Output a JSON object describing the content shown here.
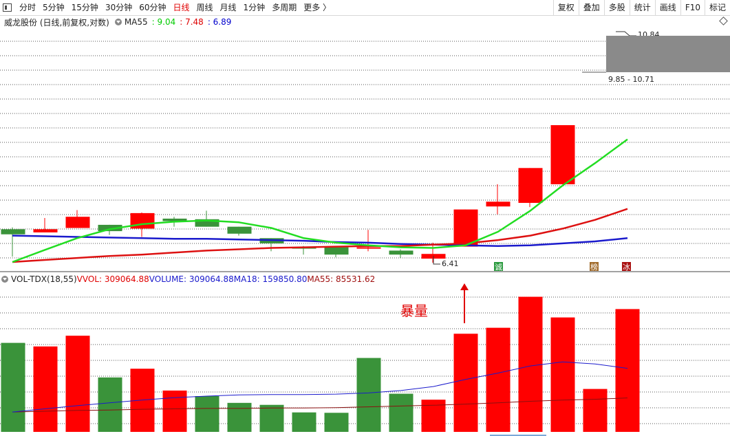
{
  "toolbar": {
    "tabs": [
      "分时",
      "5分钟",
      "15分钟",
      "30分钟",
      "60分钟",
      "日线",
      "周线",
      "月线",
      "1分钟",
      "多周期",
      "更多 〉"
    ],
    "active_tab": "日线",
    "right_buttons": [
      "复权",
      "叠加",
      "多股",
      "统计",
      "画线",
      "F10",
      "标记"
    ]
  },
  "price_panel": {
    "title": "威龙股份 (日线,前复权,对数)",
    "ma_label": "MA55",
    "ma_values": [
      ": 9.04",
      ": 7.48",
      ": 6.89"
    ],
    "ma_colors": [
      "#00cc00",
      "#dd0000",
      "#0000cc"
    ],
    "high_label": "10.84",
    "low_label": "6.41",
    "range_label": "9.85 - 10.71",
    "markers": [
      {
        "text": "诚",
        "color": "#2a9a3e"
      },
      {
        "text": "榜",
        "color": "#a06a2a"
      },
      {
        "text": "冰",
        "color": "#aa1111"
      }
    ]
  },
  "volume_panel": {
    "indicator": "VOL-TDX(18,55)",
    "vvol": "VVOL: 309064.88",
    "volume": "VOLUME: 309064.88",
    "ma18": "MA18: 159850.80",
    "ma55": "MA55: 85531.62",
    "annotation": "暴量"
  },
  "colors": {
    "up": "#ff0000",
    "down": "#3a933a",
    "ma_short": "#22dd22",
    "ma_mid": "#dd1111",
    "ma_long": "#1a1acc"
  },
  "chart_data": {
    "type": "candlestick",
    "scale": "log",
    "ylim": [
      6.41,
      10.84
    ],
    "candles": [
      {
        "open": 6.92,
        "close": 6.84,
        "high": 6.95,
        "low": 6.5
      },
      {
        "open": 6.87,
        "close": 6.92,
        "high": 7.1,
        "low": 6.87
      },
      {
        "open": 6.94,
        "close": 7.12,
        "high": 7.23,
        "low": 6.94
      },
      {
        "open": 6.99,
        "close": 6.89,
        "high": 6.99,
        "low": 6.83
      },
      {
        "open": 6.93,
        "close": 7.18,
        "high": 7.19,
        "low": 6.8
      },
      {
        "open": 7.09,
        "close": 7.05,
        "high": 7.12,
        "low": 6.96
      },
      {
        "open": 7.08,
        "close": 6.96,
        "high": 7.22,
        "low": 6.96
      },
      {
        "open": 6.96,
        "close": 6.85,
        "high": 6.96,
        "low": 6.82
      },
      {
        "open": 6.78,
        "close": 6.7,
        "high": 6.78,
        "low": 6.58
      },
      {
        "open": 6.64,
        "close": 6.62,
        "high": 6.66,
        "low": 6.53
      },
      {
        "open": 6.64,
        "close": 6.53,
        "high": 6.64,
        "low": 6.49
      },
      {
        "open": 6.63,
        "close": 6.64,
        "high": 6.91,
        "low": 6.58
      },
      {
        "open": 6.59,
        "close": 6.53,
        "high": 6.61,
        "low": 6.48
      },
      {
        "open": 6.47,
        "close": 6.54,
        "high": 6.71,
        "low": 6.41
      },
      {
        "open": 6.65,
        "close": 7.24,
        "high": 7.24,
        "low": 6.65
      },
      {
        "open": 7.29,
        "close": 7.37,
        "high": 7.67,
        "low": 7.16
      },
      {
        "open": 7.35,
        "close": 7.96,
        "high": 7.96,
        "low": 7.28
      },
      {
        "open": 7.67,
        "close": 8.78,
        "high": 8.78,
        "low": 7.67
      }
    ],
    "ma_short": [
      6.42,
      6.6,
      6.78,
      6.92,
      7.0,
      7.04,
      7.06,
      7.03,
      6.94,
      6.78,
      6.71,
      6.67,
      6.64,
      6.63,
      6.67,
      6.88,
      7.22,
      7.65,
      8.05,
      8.5
    ],
    "ma_mid": [
      6.42,
      6.45,
      6.48,
      6.51,
      6.53,
      6.56,
      6.59,
      6.61,
      6.63,
      6.64,
      6.65,
      6.66,
      6.66,
      6.68,
      6.7,
      6.75,
      6.82,
      6.93,
      7.07,
      7.25
    ],
    "ma_long": [
      6.82,
      6.81,
      6.8,
      6.79,
      6.78,
      6.77,
      6.77,
      6.76,
      6.75,
      6.74,
      6.72,
      6.71,
      6.69,
      6.68,
      6.67,
      6.66,
      6.67,
      6.7,
      6.73,
      6.78
    ],
    "volume": {
      "ylim": [
        0,
        360000
      ],
      "values": [
        224000,
        215000,
        242000,
        137000,
        159000,
        104000,
        90000,
        73000,
        68000,
        49000,
        48000,
        186000,
        96000,
        81000,
        247000,
        262000,
        340000,
        288000,
        108000,
        309064.88
      ],
      "up": [
        false,
        true,
        true,
        false,
        true,
        true,
        false,
        false,
        false,
        false,
        false,
        false,
        false,
        true,
        true,
        true,
        true,
        true,
        true,
        true
      ],
      "ma18": [
        50000,
        58000,
        66000,
        73000,
        80000,
        86000,
        90000,
        93000,
        94000,
        94000,
        95000,
        98000,
        104000,
        114000,
        132000,
        148000,
        166000,
        176000,
        171000,
        159850.8
      ],
      "ma55": [
        50000,
        52000,
        54000,
        55000,
        57000,
        58000,
        59000,
        59000,
        60000,
        60000,
        61000,
        63000,
        65000,
        67000,
        70000,
        73000,
        77000,
        80000,
        82000,
        85531.62
      ]
    }
  }
}
